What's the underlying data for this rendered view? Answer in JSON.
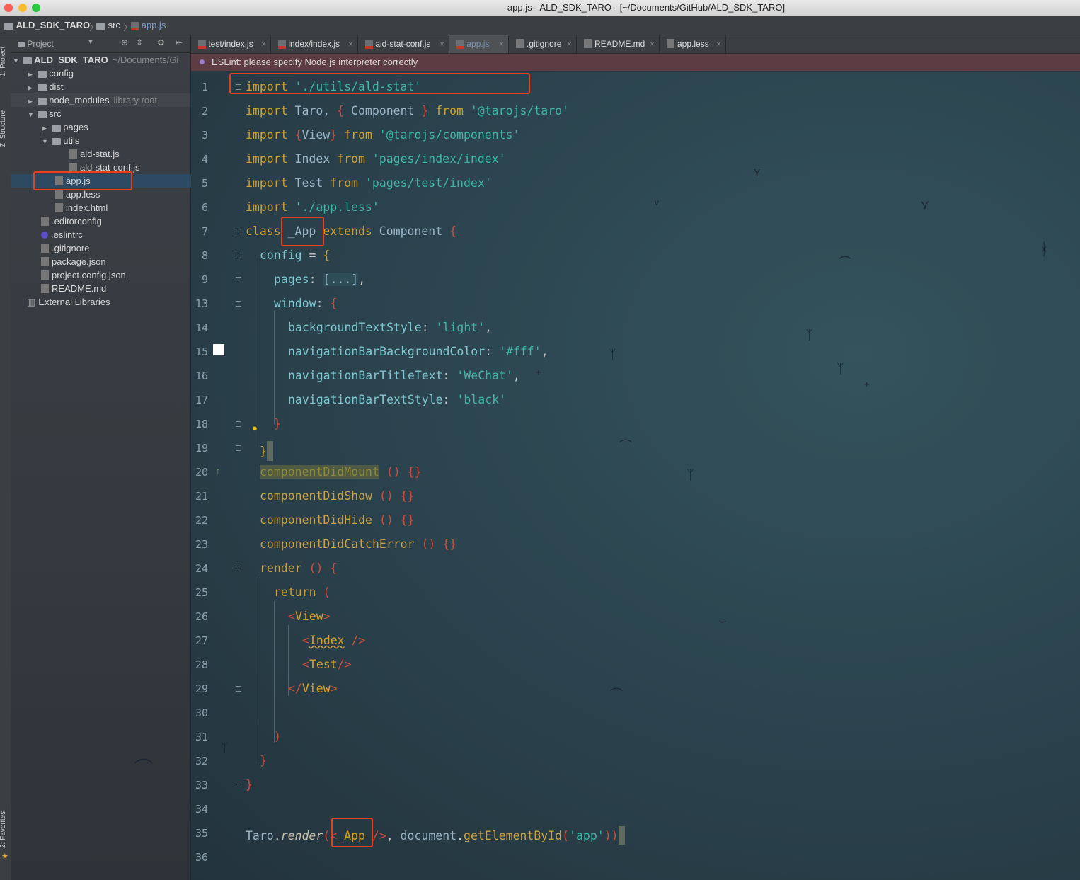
{
  "window": {
    "title": "app.js - ALD_SDK_TARO - [~/Documents/GitHub/ALD_SDK_TARO]"
  },
  "breadcrumb": {
    "root": "ALD_SDK_TARO",
    "folder": "src",
    "file": "app.js"
  },
  "tool_windows": {
    "project": "1: Project",
    "structure": "Z: Structure",
    "favorites": "2: Favorites"
  },
  "project_panel": {
    "title": "Project",
    "root_name": "ALD_SDK_TARO",
    "root_path": "~/Documents/Gi",
    "items": [
      {
        "label": "config"
      },
      {
        "label": "dist"
      },
      {
        "label": "node_modules",
        "note": "library root"
      },
      {
        "label": "src"
      },
      {
        "label": "pages"
      },
      {
        "label": "utils"
      },
      {
        "label": "ald-stat.js"
      },
      {
        "label": "ald-stat-conf.js"
      },
      {
        "label": "app.js"
      },
      {
        "label": "app.less"
      },
      {
        "label": "index.html"
      },
      {
        "label": ".editorconfig"
      },
      {
        "label": ".eslintrc"
      },
      {
        "label": ".gitignore"
      },
      {
        "label": "package.json"
      },
      {
        "label": "project.config.json"
      },
      {
        "label": "README.md"
      },
      {
        "label": "External Libraries"
      }
    ]
  },
  "tabs": [
    {
      "label": "test/index.js"
    },
    {
      "label": "index/index.js"
    },
    {
      "label": "ald-stat-conf.js"
    },
    {
      "label": "app.js",
      "active": true
    },
    {
      "label": ".gitignore"
    },
    {
      "label": "README.md"
    },
    {
      "label": "app.less"
    }
  ],
  "notification": "ESLint: please specify Node.js interpreter correctly",
  "line_numbers": [
    "1",
    "2",
    "3",
    "4",
    "5",
    "6",
    "7",
    "8",
    "9",
    "13",
    "14",
    "15",
    "16",
    "17",
    "18",
    "19",
    "20",
    "21",
    "22",
    "23",
    "24",
    "25",
    "26",
    "27",
    "28",
    "29",
    "30",
    "31",
    "32",
    "33",
    "34",
    "35",
    "36"
  ],
  "code": {
    "l1": [
      "import",
      " './utils/ald-stat'"
    ],
    "l2": [
      "import",
      " Taro, ",
      "{",
      " Component ",
      "}",
      " from ",
      "'@tarojs/taro'"
    ],
    "l3": [
      "import",
      " ",
      "{",
      "View",
      "}",
      " from ",
      "'@tarojs/components'"
    ],
    "l4": [
      "import",
      " Index ",
      "from",
      " 'pages/index/index'"
    ],
    "l5": [
      "import",
      " Test ",
      "from",
      " 'pages/test/index'"
    ],
    "l6": [
      "import",
      " './app.less'"
    ],
    "l7": [
      "class",
      " _App ",
      "extends",
      " Component ",
      "{"
    ],
    "l8": [
      "config",
      " = ",
      "{"
    ],
    "l9": [
      "pages",
      ": ",
      "[...]",
      ","
    ],
    "l13": [
      "window",
      ": ",
      "{"
    ],
    "l14": [
      "backgroundTextStyle",
      ": ",
      "'light'",
      ","
    ],
    "l15": [
      "navigationBarBackgroundColor",
      ": ",
      "'#fff'",
      ","
    ],
    "l16": [
      "navigationBarTitleText",
      ": ",
      "'WeChat'",
      ","
    ],
    "l17": [
      "navigationBarTextStyle",
      ": ",
      "'black'"
    ],
    "l18": [
      "}"
    ],
    "l19": [
      "}"
    ],
    "l20": [
      "componentDidMount",
      " ()",
      " {}"
    ],
    "l21": [
      "componentDidShow",
      " ()",
      " {}"
    ],
    "l22": [
      "componentDidHide",
      " ()",
      " {}"
    ],
    "l23": [
      "componentDidCatchError",
      " ()",
      " {}"
    ],
    "l24": [
      "render",
      " ()",
      " {"
    ],
    "l25": [
      "return",
      " ("
    ],
    "l26": [
      "<",
      "View",
      ">"
    ],
    "l27": [
      "<",
      "Index",
      " />"
    ],
    "l28": [
      "<",
      "Test",
      "/>"
    ],
    "l29": [
      "</",
      "View",
      ">"
    ],
    "l31": [
      ")"
    ],
    "l32": [
      "}"
    ],
    "l33": [
      "}"
    ],
    "l35": [
      "Taro",
      ".",
      "render",
      "(",
      "<",
      "_App",
      " />",
      ", ",
      "document",
      ".",
      "getElementById",
      "(",
      "'app'",
      ")",
      ")"
    ]
  },
  "colors": {
    "highlight": "#e8401c",
    "selection": "#2e4a63"
  }
}
